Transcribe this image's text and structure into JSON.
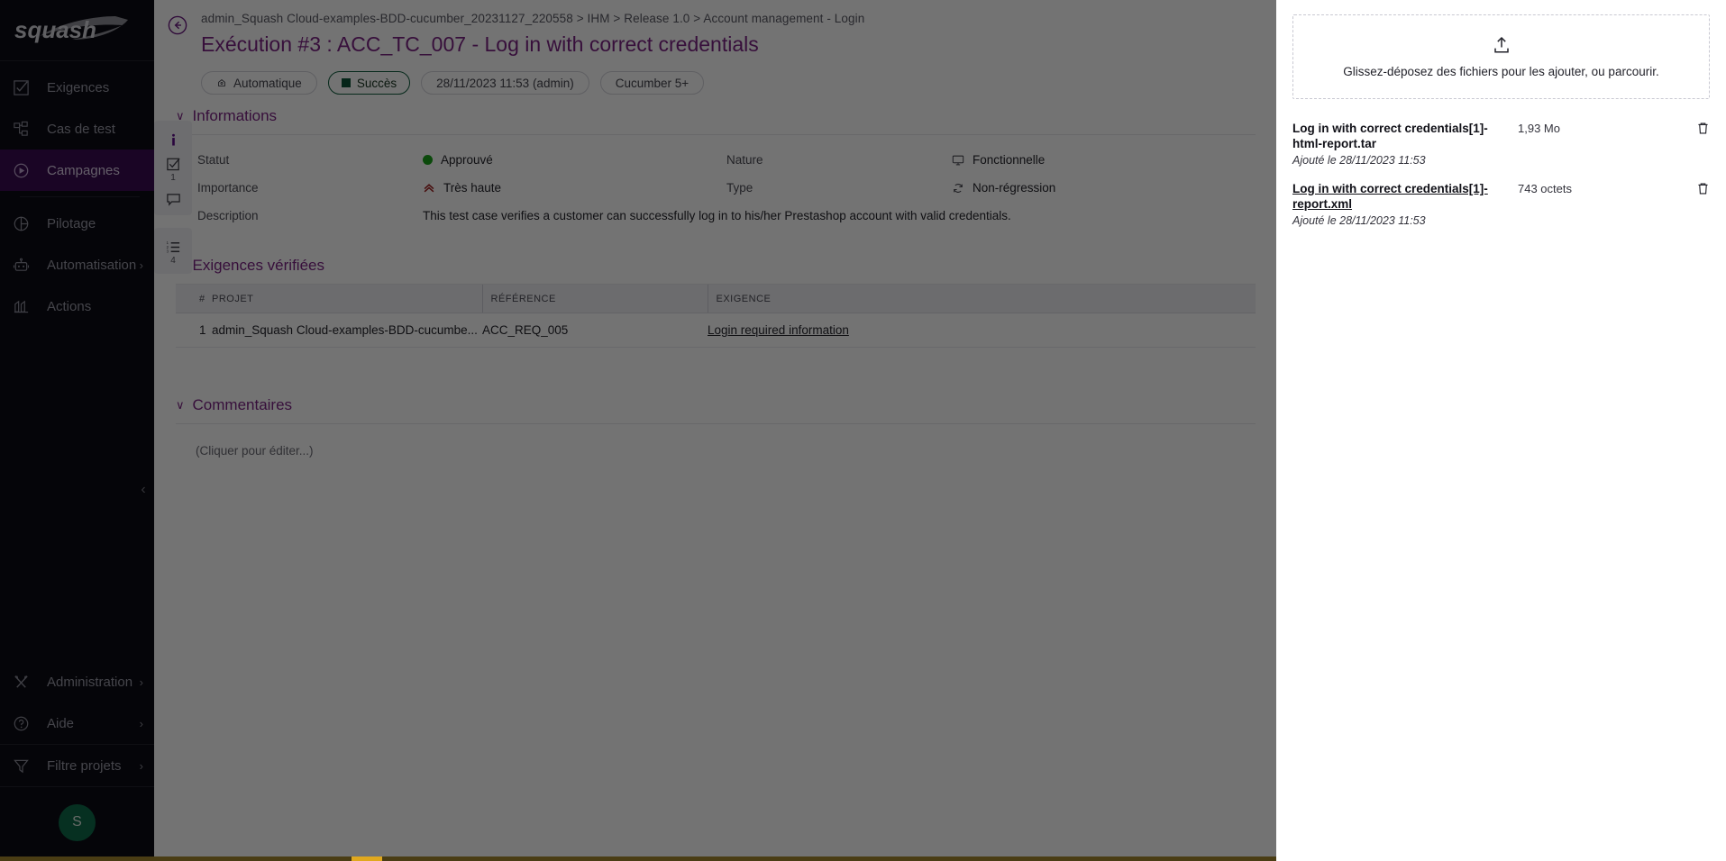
{
  "app": {
    "logo_text": "squash"
  },
  "sidebar": {
    "items": [
      {
        "label": "Exigences",
        "icon": "requirements-icon",
        "active": false,
        "caret": false
      },
      {
        "label": "Cas de test",
        "icon": "test-case-icon",
        "active": false,
        "caret": false
      },
      {
        "label": "Campagnes",
        "icon": "campaign-play-icon",
        "active": true,
        "caret": false
      },
      {
        "label": "Pilotage",
        "icon": "chart-pie-icon",
        "active": false,
        "caret": false
      },
      {
        "label": "Automatisation",
        "icon": "robot-icon",
        "active": false,
        "caret": true
      },
      {
        "label": "Actions",
        "icon": "actions-icon",
        "active": false,
        "caret": false
      }
    ],
    "bottom_items": [
      {
        "label": "Administration",
        "icon": "tools-icon",
        "caret": true
      },
      {
        "label": "Aide",
        "icon": "help-circle-icon",
        "caret": true
      },
      {
        "label": "Filtre projets",
        "icon": "filter-icon",
        "caret": true
      }
    ],
    "avatar_initial": "S",
    "collapse_icon": "chevron-left-icon"
  },
  "icon_rail": [
    {
      "name": "info-icon",
      "badge": "",
      "active": true
    },
    {
      "name": "checklist-icon",
      "badge": "1",
      "active": false
    },
    {
      "name": "comment-icon",
      "badge": "",
      "active": false
    },
    {
      "name": "list-ordered-icon",
      "badge": "4",
      "active": false
    }
  ],
  "header": {
    "back_icon": "back-circle-icon",
    "breadcrumb": "admin_Squash Cloud-examples-BDD-cucumber_20231127_220558 > IHM > Release 1.0 > Account management - Login",
    "title": "Exécution #3 : ACC_TC_007 - Log in with correct credentials",
    "chips": [
      {
        "label": "Automatique",
        "icon": "gear-small-icon",
        "type": "plain"
      },
      {
        "label": "Succès",
        "icon": "status-square-icon",
        "type": "success"
      },
      {
        "label": "28/11/2023 11:53 (admin)",
        "icon": "",
        "type": "plain"
      },
      {
        "label": "Cucumber 5+",
        "icon": "",
        "type": "plain"
      }
    ]
  },
  "informations": {
    "section_title": "Informations",
    "rows": [
      {
        "label": "Statut",
        "value": "Approuvé",
        "marker": "dot-green",
        "label2": "Nature",
        "value2": "Fonctionnelle",
        "marker2": "screen-icon"
      },
      {
        "label": "Importance",
        "value": "Très haute",
        "marker": "chevrons-up-icon",
        "label2": "Type",
        "value2": "Non-régression",
        "marker2": "refresh-icon"
      }
    ],
    "description_label": "Description",
    "description_value": "This test case verifies a customer can successfully log in to his/her Prestashop account with valid credentials."
  },
  "requirements": {
    "section_title": "Exigences vérifiées",
    "columns": [
      "#",
      "PROJET",
      "RÉFÉRENCE",
      "EXIGENCE"
    ],
    "rows": [
      {
        "num": "1",
        "projet": "admin_Squash Cloud-examples-BDD-cucumbe...",
        "reference": "ACC_REQ_005",
        "exigence": "Login required information"
      }
    ]
  },
  "comments": {
    "section_title": "Commentaires",
    "placeholder": "(Cliquer pour éditer...)"
  },
  "attachments": {
    "dropzone_icon": "upload-icon",
    "dropzone_text": "Glissez-déposez des fichiers pour les ajouter, ou parcourir.",
    "items": [
      {
        "name": "Log in with correct credentials[1]-html-report.tar",
        "size": "1,93 Mo",
        "date": "Ajouté le 28/11/2023 11:53",
        "underlined": false,
        "delete_icon": "trash-icon"
      },
      {
        "name": "Log in with correct credentials[1]-report.xml",
        "size": "743 octets",
        "date": "Ajouté le 28/11/2023 11:53",
        "underlined": true,
        "delete_icon": "trash-icon"
      }
    ]
  },
  "colors": {
    "accent_purple": "#7b2384",
    "sidebar_bg": "#0c0c14",
    "active_nav": "#3b0d52",
    "success_green": "#0d5538",
    "status_dot": "#19a319",
    "avatar_green": "#0f6a4a",
    "gold": "#e0a81e"
  }
}
